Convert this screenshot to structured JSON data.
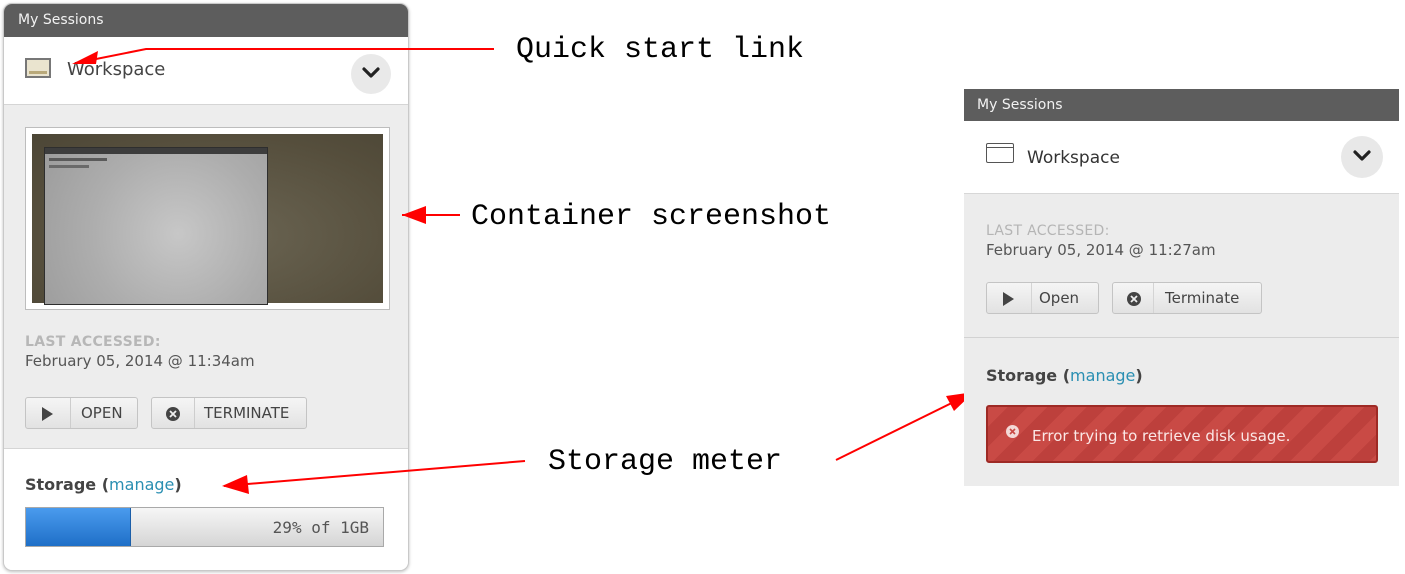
{
  "left_panel": {
    "header": "My Sessions",
    "workspace_label": "Workspace",
    "last_accessed_label": "LAST ACCESSED:",
    "last_accessed_value": "February 05, 2014 @ 11:34am",
    "open_label": "OPEN",
    "terminate_label": "TERMINATE",
    "storage_label": "Storage",
    "paren_open": " (",
    "manage_label": "manage",
    "paren_close": ")",
    "storage_usage_percent": 29,
    "storage_text": "29% of 1GB"
  },
  "right_panel": {
    "header": "My Sessions",
    "workspace_label": "Workspace",
    "last_accessed_label": "LAST ACCESSED:",
    "last_accessed_value": "February 05, 2014 @ 11:27am",
    "open_label": "Open",
    "terminate_label": "Terminate",
    "storage_label": "Storage",
    "paren_open": " (",
    "manage_label": "manage",
    "paren_close": ")",
    "error_message": "Error trying to retrieve disk usage."
  },
  "annotations": {
    "quick_start": "Quick start link",
    "container_screenshot": "Container screenshot",
    "storage_meter": "Storage meter"
  },
  "colors": {
    "header_bg": "#5d5d5d",
    "link": "#2a8fb2",
    "meter_fill": "#1f6fc7",
    "error_bg": "#c94a45",
    "arrow": "#ff0000"
  },
  "icons": [
    "workspace-icon",
    "chevron-down-icon",
    "play-icon",
    "close-circle-icon",
    "error-icon"
  ]
}
